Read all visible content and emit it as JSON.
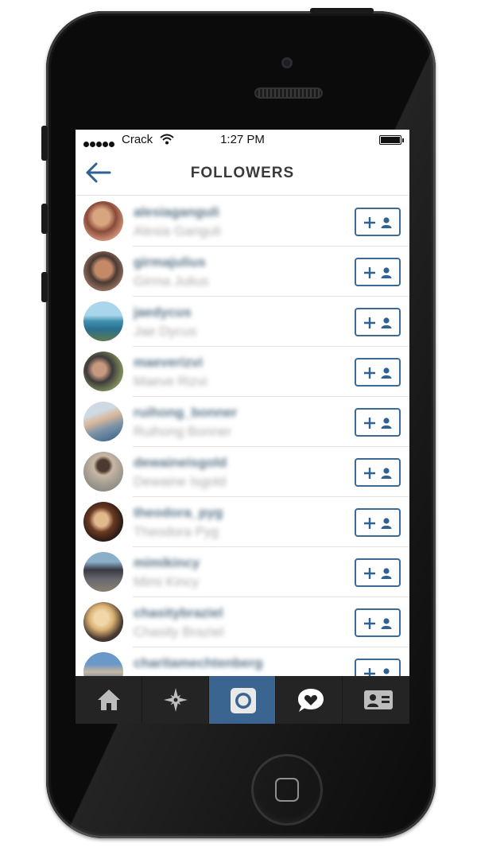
{
  "status_bar": {
    "carrier": "Crack",
    "time": "1:27 PM"
  },
  "header": {
    "title": "FOLLOWERS"
  },
  "followers": [
    {
      "username": "alesiaganguli",
      "full_name": "Alesia Ganguli"
    },
    {
      "username": "girmajulius",
      "full_name": "Girma Julius"
    },
    {
      "username": "jaedycus",
      "full_name": "Jae Dycus"
    },
    {
      "username": "maeverizvi",
      "full_name": "Maeve Rizvi"
    },
    {
      "username": "ruihong_bonner",
      "full_name": "Ruihong Bonner"
    },
    {
      "username": "dewaineisgold",
      "full_name": "Dewaine Isgold"
    },
    {
      "username": "theodora_pyg",
      "full_name": "Theodora Pyg"
    },
    {
      "username": "mimikincy",
      "full_name": "Mimi Kincy"
    },
    {
      "username": "chasitybraziel",
      "full_name": "Chasity Braziel"
    },
    {
      "username": "charitamechtenberg",
      "full_name": ""
    }
  ],
  "tabs": [
    "home-icon",
    "explore-icon",
    "camera-icon",
    "activity-icon",
    "profile-icon"
  ],
  "active_tab": "camera-icon",
  "colors": {
    "accent": "#3b6591",
    "username": "#5a7487",
    "tabbar": "#242424"
  }
}
